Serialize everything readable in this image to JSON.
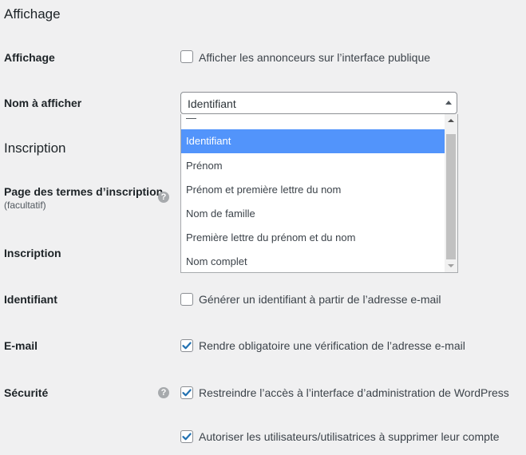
{
  "sections": {
    "display_title": "Affichage",
    "registration_title": "Inscription"
  },
  "rows": {
    "display": {
      "label": "Affichage",
      "checkbox_label": "Afficher les annonceurs sur l’interface publique",
      "checked": false
    },
    "display_name": {
      "label": "Nom à afficher",
      "selected_value": "Identifiant",
      "options": [
        "—",
        "Identifiant",
        "Prénom",
        "Prénom et première lettre du nom",
        "Nom de famille",
        "Première lettre du prénom et du nom",
        "Nom complet"
      ]
    },
    "terms_page": {
      "label": "Page des termes d’inscription",
      "sublabel": "(facultatif)",
      "help_icon": "?"
    },
    "registration": {
      "label": "Inscription"
    },
    "username": {
      "label": "Identifiant",
      "checkbox_label": "Générer un identifiant à partir de l’adresse e-mail",
      "checked": false
    },
    "email": {
      "label": "E-mail",
      "checkbox_label": "Rendre obligatoire une vérification de l’adresse e-mail",
      "checked": true
    },
    "security": {
      "label": "Sécurité",
      "help_icon": "?",
      "checkbox_label": "Restreindre l’accès à l’interface d’administration de WordPress",
      "checked": true
    },
    "delete_account": {
      "checkbox_label": "Autoriser les utilisateurs/utilisatrices à supprimer leur compte",
      "checked": true
    }
  },
  "colors": {
    "background": "#f0f0f1",
    "selected_option": "#5294fb",
    "checkmark": "#2271b1"
  }
}
